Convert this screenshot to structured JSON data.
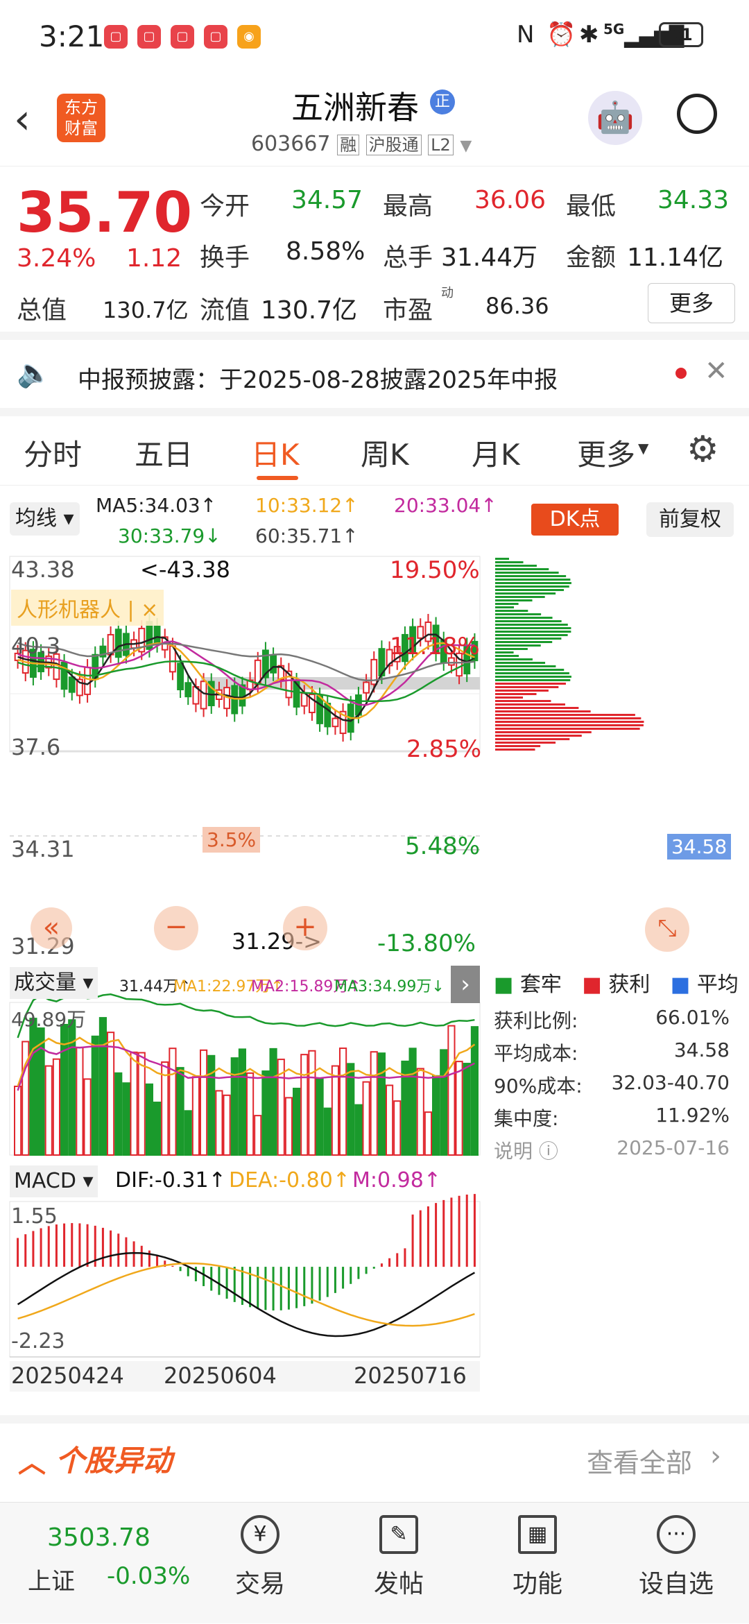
{
  "status": {
    "time": "3:21",
    "network": "5G",
    "battery": "81"
  },
  "header": {
    "title": "五洲新春",
    "badge": "正",
    "code": "603667",
    "tags": [
      "融",
      "沪股通",
      "L2"
    ],
    "logo": "东方财富"
  },
  "quote": {
    "price": "35.70",
    "change_pct": "3.24%",
    "change": "1.12",
    "open_label": "今开",
    "open": "34.57",
    "high_label": "最高",
    "high": "36.06",
    "low_label": "最低",
    "low": "34.33",
    "turnover_label": "换手",
    "turnover": "8.58%",
    "volume_label": "总手",
    "volume": "31.44万",
    "amount_label": "金额",
    "amount": "11.14亿",
    "mcap_label": "总值",
    "mcap": "130.7亿",
    "float_label": "流值",
    "float": "130.7亿",
    "pe_label": "市盈",
    "pe_sup": "动",
    "pe": "86.36",
    "more": "更多"
  },
  "notice": {
    "text": "中报预披露：于2025-08-28披露2025年中报"
  },
  "tabs": [
    "分时",
    "五日",
    "日K",
    "周K",
    "月K",
    "更多"
  ],
  "active_tab": "日K",
  "kline": {
    "ma_label": "均线",
    "ma5": "MA5:34.03↑",
    "ma10": "10:33.12↑",
    "ma20": "20:33.04↑",
    "ma30": "30:33.79↓",
    "ma60": "60:35.71↑",
    "dk": "DK点",
    "fq": "前复权",
    "hi_axis": "43.38",
    "hi_note": "<-43.38",
    "axis2": "40.3",
    "axis3": "37.6",
    "axis4": "34.31",
    "lo_axis": "31.29",
    "lo_note": "31.29->",
    "pct1": "19.50%",
    "pct2": "11.18%",
    "pct3": "2.85%",
    "pct4": "5.48%",
    "pct5": "-13.80%",
    "concept": "人形机器人 | ×",
    "box": "3.5%",
    "cost_label": "34.58"
  },
  "vol": {
    "label": "成交量",
    "v": "31.44万↑",
    "ma1": "MA1:22.97万↑",
    "ma2": "MA2:15.89万↑",
    "ma3": "MA3:34.99万↓",
    "max": "49.89万"
  },
  "macd": {
    "label": "MACD",
    "dif": "DIF:-0.31↑",
    "dea": "DEA:-0.80↑",
    "m": "M:0.98↑",
    "hi": "1.55",
    "lo": "-2.23"
  },
  "dates": [
    "20250424",
    "20250604",
    "20250716"
  ],
  "chips": {
    "legend": [
      "套牢",
      "获利",
      "平均"
    ],
    "rows": [
      [
        "获利比例:",
        "66.01%"
      ],
      [
        "平均成本:",
        "34.58"
      ],
      [
        "90%成本:",
        "32.03-40.70"
      ],
      [
        "集中度:",
        "11.92%"
      ]
    ],
    "note": "说明",
    "date": "2025-07-16"
  },
  "movement": {
    "title": "个股异动",
    "all": "查看全部"
  },
  "bottom": {
    "index_val": "3503.78",
    "index_name": "上证",
    "index_chg": "-0.03%",
    "items": [
      "交易",
      "发帖",
      "功能",
      "设自选"
    ]
  }
}
